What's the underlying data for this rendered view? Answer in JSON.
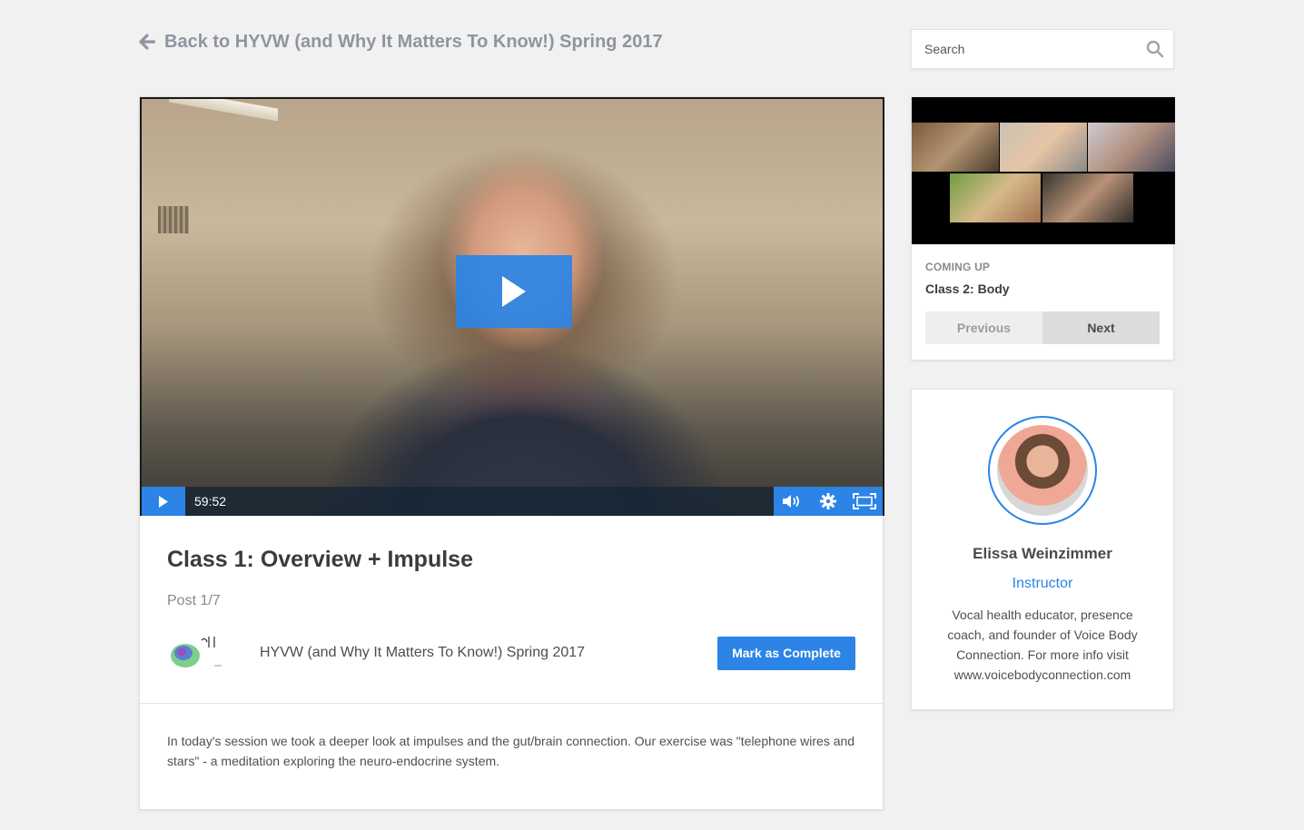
{
  "back_link": {
    "label": "Back to HYVW (and Why It Matters To Know!) Spring 2017"
  },
  "search": {
    "placeholder": "Search"
  },
  "video": {
    "duration": "59:52"
  },
  "post": {
    "title": "Class 1: Overview + Impulse",
    "count": "Post 1/7",
    "course_name": "HYVW (and Why It Matters To Know!) Spring 2017",
    "complete_label": "Mark as Complete",
    "description": "In today's session we took a deeper look at impulses and the gut/brain connection. Our exercise was \"telephone wires and stars\" - a meditation exploring the neuro-endocrine system."
  },
  "coming_up": {
    "label": "COMING UP",
    "title": "Class 2: Body",
    "prev_label": "Previous",
    "next_label": "Next"
  },
  "instructor": {
    "name": "Elissa Weinzimmer",
    "role": "Instructor",
    "bio": "Vocal health educator, presence coach, and founder of Voice Body Connection. For more info visit www.voicebodyconnection.com"
  },
  "colors": {
    "accent": "#2b84e6",
    "background": "#f1f1f1"
  },
  "icons": [
    "arrow-left-icon",
    "search-icon",
    "play-icon",
    "volume-icon",
    "gear-icon",
    "fullscreen-icon"
  ]
}
